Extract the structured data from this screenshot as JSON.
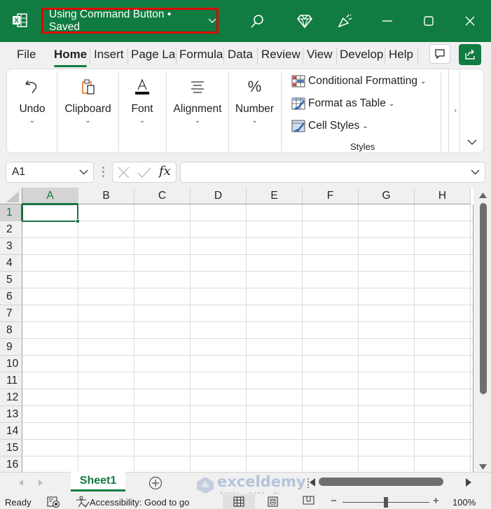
{
  "titlebar": {
    "doc_title": "Using Command Button • Saved",
    "app_icon": "excel-icon",
    "icons": [
      "search-icon",
      "diamond-premium-icon",
      "celebrate-feedback-icon",
      "minimize-icon",
      "maximize-icon",
      "close-icon"
    ]
  },
  "menu": {
    "tabs": [
      {
        "label": "File"
      },
      {
        "label": "Home",
        "active": true
      },
      {
        "label": "Insert"
      },
      {
        "label": "Page Layout",
        "visible_text": "Page La"
      },
      {
        "label": "Formulas",
        "visible_text": "Formula"
      },
      {
        "label": "Data"
      },
      {
        "label": "Review"
      },
      {
        "label": "View"
      },
      {
        "label": "Developer",
        "visible_text": "Develop"
      },
      {
        "label": "Help"
      }
    ],
    "comment_icon": "comment-icon",
    "share_icon": "share-icon"
  },
  "ribbon": {
    "groups": [
      {
        "label": "Undo",
        "icon": "undo-icon"
      },
      {
        "label": "Clipboard",
        "icon": "clipboard-icon"
      },
      {
        "label": "Font",
        "icon": "font-color-icon"
      },
      {
        "label": "Alignment",
        "icon": "align-center-icon"
      },
      {
        "label": "Number",
        "icon": "percent-icon"
      }
    ],
    "styles": {
      "items": [
        {
          "label": "Conditional Formatting",
          "icon": "conditional-formatting-icon"
        },
        {
          "label": "Format as Table",
          "icon": "format-as-table-icon"
        },
        {
          "label": "Cell Styles",
          "icon": "cell-styles-icon"
        }
      ],
      "group_label": "Styles"
    },
    "expand_icon": "chevron-right-icon",
    "collapse_icon": "chevron-down-icon"
  },
  "formula_bar": {
    "name_box": "A1",
    "formula_value": "",
    "fx_label": "fx"
  },
  "grid": {
    "columns": [
      "A",
      "B",
      "C",
      "D",
      "E",
      "F",
      "G",
      "H"
    ],
    "rows": [
      "1",
      "2",
      "3",
      "4",
      "5",
      "6",
      "7",
      "8",
      "9",
      "10",
      "11",
      "12",
      "13",
      "14",
      "15",
      "16"
    ],
    "active_cell": "A1"
  },
  "sheets": {
    "tabs": [
      "Sheet1"
    ],
    "active": "Sheet1"
  },
  "status": {
    "ready": "Ready",
    "accessibility": "Accessibility: Good to go",
    "zoom": "100%",
    "zoom_minus": "−",
    "zoom_plus": "+"
  },
  "watermark": {
    "brand": "exceldemy",
    "tagline": "EXCEL · DATA · BI"
  }
}
